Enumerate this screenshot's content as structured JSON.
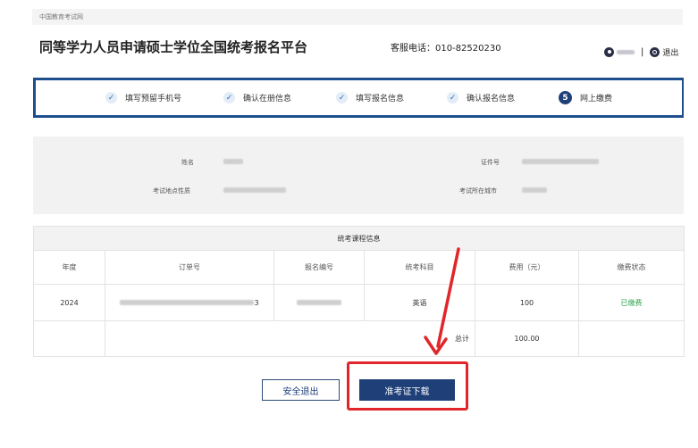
{
  "site": {
    "label": "中国教育考试网"
  },
  "header": {
    "title": "同等学力人员申请硕士学位全国统考报名平台",
    "hotline": "客服电话：010-82520230",
    "separator": "|",
    "logout_label": "退出"
  },
  "steps": [
    {
      "label": "填写预留手机号",
      "status": "done",
      "marker": "✓"
    },
    {
      "label": "确认在册信息",
      "status": "done",
      "marker": "✓"
    },
    {
      "label": "填写报名信息",
      "status": "done",
      "marker": "✓"
    },
    {
      "label": "确认报名信息",
      "status": "done",
      "marker": "✓"
    },
    {
      "label": "网上缴费",
      "status": "current",
      "marker": "5"
    }
  ],
  "info": {
    "name_label": "姓名",
    "id_label": "证件号",
    "exam_site_label": "考试地点性质",
    "exam_city_label": "考试所在城市"
  },
  "course": {
    "title": "统考课程信息",
    "columns": [
      "年度",
      "订单号",
      "报名编号",
      "统考科目",
      "费用（元）",
      "缴费状态"
    ],
    "rows": [
      {
        "year": "2024",
        "order_suffix": "3",
        "subject": "英语",
        "fee": "100",
        "status": "已缴费"
      }
    ],
    "total_label": "总计",
    "total_value": "100.00"
  },
  "buttons": {
    "exit": "安全退出",
    "download": "准考证下载"
  },
  "colors": {
    "primary": "#1e3f78",
    "annotation": "#e0262a",
    "paid": "#2aa54b"
  }
}
